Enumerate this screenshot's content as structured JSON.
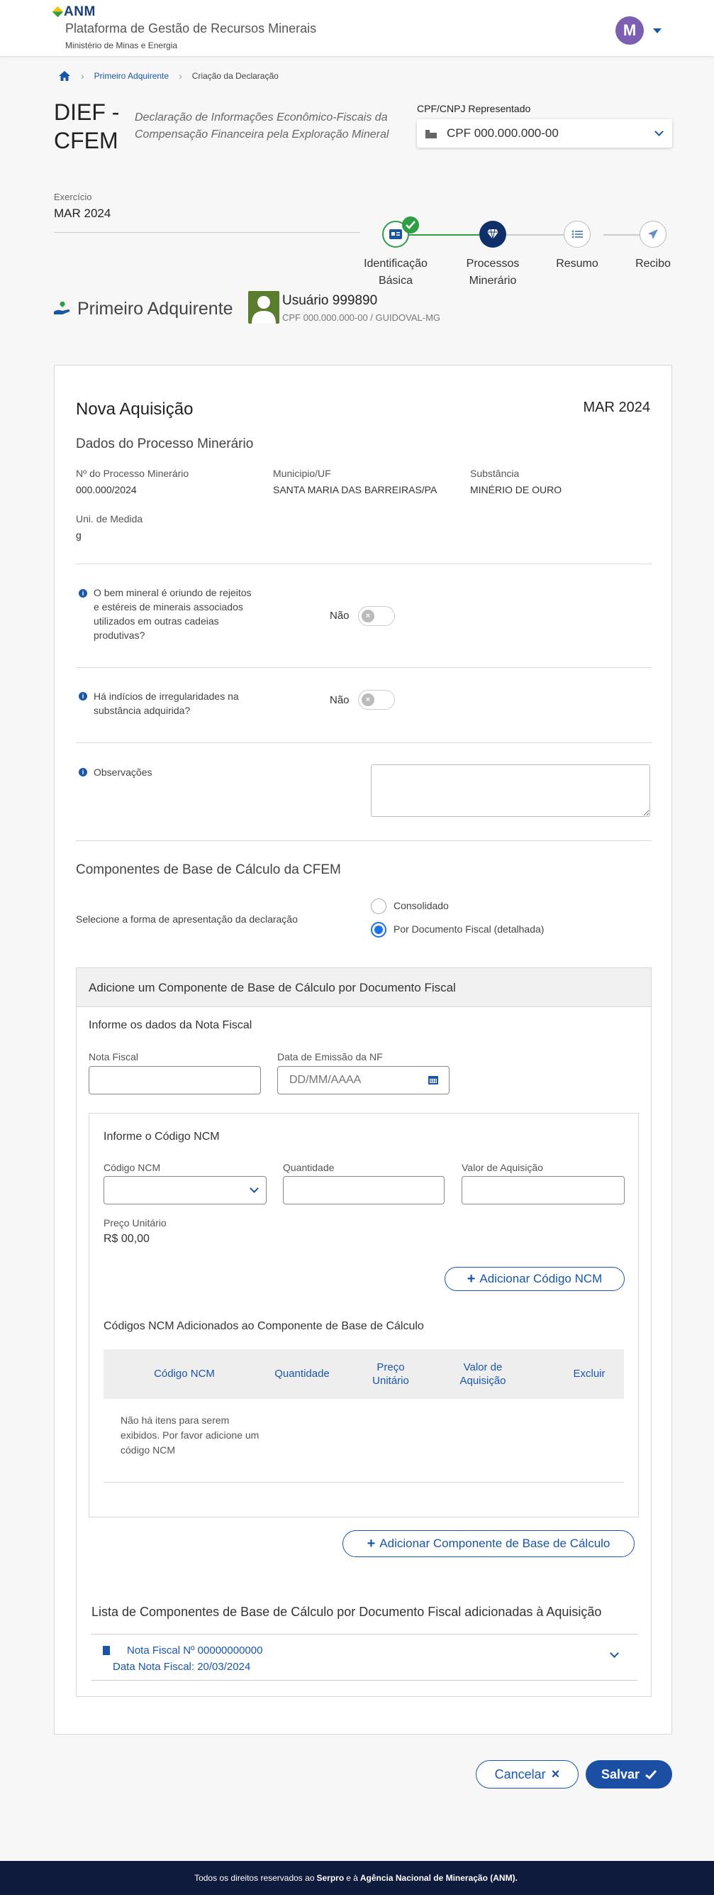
{
  "header": {
    "logo_text": "ANM",
    "platform_name": "Plataforma de Gestão de Recursos Minerais",
    "ministry": "Ministério de Minas e Energia",
    "avatar_initial": "M"
  },
  "breadcrumb": {
    "items": [
      "Primeiro Adquirente",
      "Criação da Declaração"
    ]
  },
  "title": {
    "main": "DIEF - CFEM",
    "description": "Declaração de Informações Econômico-Fiscais da Compensação Financeira pela Exploração Mineral"
  },
  "cpf": {
    "label": "CPF/CNPJ Representado",
    "selected": "CPF 000.000.000-00"
  },
  "exercicio": {
    "label": "Exercício",
    "value": "MAR 2024"
  },
  "stepper": {
    "steps": [
      {
        "label": "Identificação Básica",
        "status": "completed"
      },
      {
        "label": "Processos Minerário",
        "status": "current"
      },
      {
        "label": "Resumo",
        "status": "pending"
      },
      {
        "label": "Recibo",
        "status": "pending"
      }
    ]
  },
  "profile": {
    "section_title": "Primeiro Adquirente",
    "user_name": "Usuário 999890",
    "user_cpf": "CPF 000.000.000-00 / GUIDOVAL-MG"
  },
  "card": {
    "title": "Nova Aquisição",
    "period": "MAR 2024",
    "subtitle": "Dados do Processo Minerário",
    "fields": {
      "processo_label": "Nº do Processo Minerário",
      "processo_value": "000.000/2024",
      "municipio_label": "Municipio/UF",
      "municipio_value": "SANTA MARIA DAS BARREIRAS/PA",
      "substancia_label": "Substância",
      "substancia_value": "MINÉRIO DE OURO",
      "unidade_label": "Uni. de Medida",
      "unidade_value": "g"
    },
    "question1": "O bem mineral é oriundo de rejeitos e estéreis de minerais associados utilizados em outras cadeias produtivas?",
    "question1_answer": "Não",
    "question2": "Há indícios de irregularidades na substância adquirida?",
    "question2_answer": "Não",
    "observacoes_label": "Observações",
    "componentes_title": "Componentes de Base de Cálculo da CFEM",
    "forma_label": "Selecione a forma de apresentação da declaração",
    "radio_options": [
      "Consolidado",
      "Por Documento Fiscal (detalhada)"
    ],
    "radio_selected": "Por Documento Fiscal (detalhada)"
  },
  "panel": {
    "title": "Adicione um Componente de Base de Cálculo por Documento Fiscal",
    "nota_section": "Informe os dados da Nota Fiscal",
    "nota_label": "Nota Fiscal",
    "nota_value": "",
    "data_label": "Data de Emissão da NF",
    "data_placeholder": "DD/MM/AAAA",
    "ncm_section": "Informe o Código NCM",
    "ncm_label": "Código NCM",
    "quantidade_label": "Quantidade",
    "valor_label": "Valor de Aquisição",
    "preco_label": "Preço Unitário",
    "preco_value": "R$ 00,00",
    "add_ncm_button": "Adicionar Código NCM",
    "ncm_table_title": "Códigos NCM Adicionados ao Componente de Base de Cálculo",
    "table_headers": [
      "Código NCM",
      "Quantidade",
      "Preço Unitário",
      "Valor de Aquisição",
      "Excluir"
    ],
    "empty_message": "Não há itens para serem exibidos. Por favor adicione um código NCM",
    "add_component_button": "Adicionar Componente de Base de Cálculo",
    "list_title": "Lista de Componentes de Base de Cálculo por Documento Fiscal adicionadas à Aquisição",
    "list_items": [
      {
        "nota": "Nota Fiscal Nº 00000000000",
        "data": "Data Nota Fiscal: 20/03/2024"
      }
    ]
  },
  "actions": {
    "cancel": "Cancelar",
    "save": "Salvar"
  },
  "footer": {
    "prefix": "Todos os direitos reservados ao",
    "serpro": "Serpro",
    "middle": "e à",
    "anm": "Agência Nacional de Mineração (ANM)."
  },
  "colors": {
    "primary": "#1a56a8",
    "success": "#2f9e44",
    "footer_bg": "#0f1b3d",
    "avatar": "#7d5fb1"
  }
}
